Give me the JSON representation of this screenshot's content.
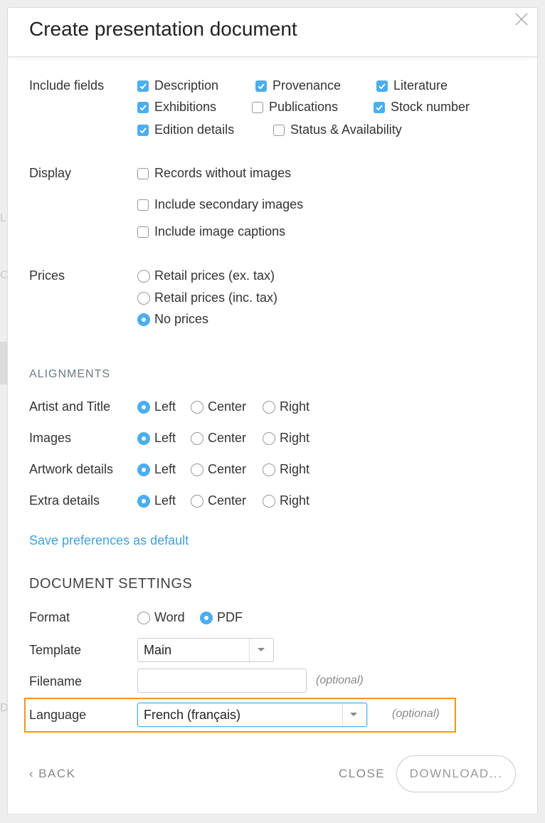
{
  "dialog": {
    "title": "Create presentation document"
  },
  "include_fields": {
    "label": "Include fields",
    "options": [
      {
        "label": "Description",
        "checked": true
      },
      {
        "label": "Provenance",
        "checked": true
      },
      {
        "label": "Literature",
        "checked": true
      },
      {
        "label": "Exhibitions",
        "checked": true
      },
      {
        "label": "Publications",
        "checked": false
      },
      {
        "label": "Stock number",
        "checked": true
      },
      {
        "label": "Edition details",
        "checked": true
      },
      {
        "label": "Status & Availability",
        "checked": false
      }
    ]
  },
  "display": {
    "label": "Display",
    "options": [
      {
        "label": "Records without images",
        "checked": false
      },
      {
        "label": "Include secondary images",
        "checked": false
      },
      {
        "label": "Include image captions",
        "checked": false
      }
    ]
  },
  "prices": {
    "label": "Prices",
    "options": [
      {
        "label": "Retail prices (ex. tax)",
        "selected": false
      },
      {
        "label": "Retail prices (inc. tax)",
        "selected": false
      },
      {
        "label": "No prices",
        "selected": true
      }
    ]
  },
  "alignments": {
    "heading": "ALIGNMENTS",
    "choices": [
      "Left",
      "Center",
      "Right"
    ],
    "rows": [
      {
        "label": "Artist and Title",
        "selected": "Left"
      },
      {
        "label": "Images",
        "selected": "Left"
      },
      {
        "label": "Artwork details",
        "selected": "Left"
      },
      {
        "label": "Extra details",
        "selected": "Left"
      }
    ]
  },
  "save_preferences_link": "Save preferences as default",
  "document_settings": {
    "heading": "DOCUMENT SETTINGS",
    "format": {
      "label": "Format",
      "options": [
        "Word",
        "PDF"
      ],
      "selected": "PDF"
    },
    "template": {
      "label": "Template",
      "value": "Main"
    },
    "filename": {
      "label": "Filename",
      "value": "",
      "optional": "(optional)"
    },
    "language": {
      "label": "Language",
      "value": "French (français)",
      "optional": "(optional)"
    }
  },
  "footer": {
    "back_label": "BACK",
    "close_label": "CLOSE",
    "download_label": "DOWNLOAD..."
  },
  "colors": {
    "accent": "#4aaef0",
    "link": "#3fa2db",
    "highlight": "#f0961e"
  }
}
